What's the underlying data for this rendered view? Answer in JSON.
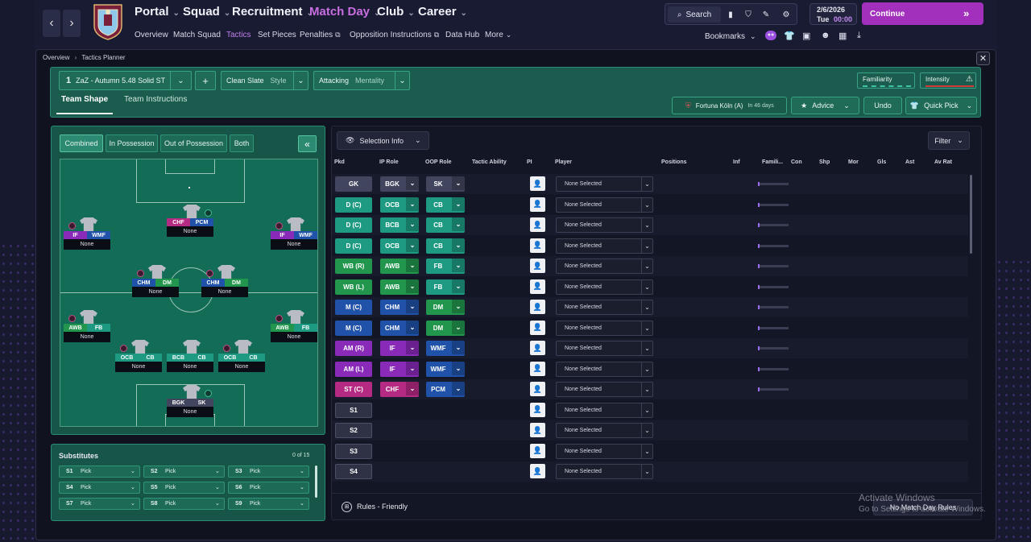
{
  "topnav": {
    "main": [
      {
        "label": "Portal"
      },
      {
        "label": "Squad"
      },
      {
        "label": "Recruitment"
      },
      {
        "label": "Match Day"
      },
      {
        "label": "Club"
      },
      {
        "label": "Career"
      }
    ],
    "sub": [
      "Overview",
      "Match Squad",
      "Tactics",
      "Set Pieces",
      "Penalties",
      "Opposition Instructions",
      "Data Hub",
      "More"
    ],
    "search": "Search",
    "date": "2/6/2026",
    "day": "Tue",
    "time": "00:00",
    "continue": "Continue",
    "bookmarks": "Bookmarks"
  },
  "breadcrumb": {
    "root": "Overview",
    "current": "Tactics Planner"
  },
  "tactic": {
    "slot": "1",
    "name": "ZaZ - Autumn 5.48 Solid ST",
    "style_value": "Clean Slate",
    "style_label": "Style",
    "mentality_value": "Attacking",
    "mentality_label": "Mentality",
    "familiarity": "Familiarity",
    "intensity": "Intensity",
    "tabs": [
      "Team Shape",
      "Team Instructions"
    ],
    "next_match": "Fortuna Köln (A)",
    "next_match_when": "In 46 days",
    "advice": "Advice",
    "undo": "Undo",
    "quick_pick": "Quick Pick"
  },
  "modes": [
    "Combined",
    "In Possession",
    "Out of Possession",
    "Both"
  ],
  "pitch_players": [
    {
      "ip": "CHF",
      "oop": "PCM",
      "name": "None"
    },
    {
      "ip": "IF",
      "oop": "WMF",
      "name": "None"
    },
    {
      "ip": "IF",
      "oop": "WMF",
      "name": "None"
    },
    {
      "ip": "CHM",
      "oop": "DM",
      "name": "None"
    },
    {
      "ip": "CHM",
      "oop": "DM",
      "name": "None"
    },
    {
      "ip": "AWB",
      "oop": "FB",
      "name": "None"
    },
    {
      "ip": "AWB",
      "oop": "FB",
      "name": "None"
    },
    {
      "ip": "OCB",
      "oop": "CB",
      "name": "None"
    },
    {
      "ip": "BCB",
      "oop": "CB",
      "name": "None"
    },
    {
      "ip": "OCB",
      "oop": "CB",
      "name": "None"
    },
    {
      "ip": "BGK",
      "oop": "SK",
      "name": "None"
    }
  ],
  "subs": {
    "title": "Substitutes",
    "count": "0 of 15",
    "slots": [
      {
        "s": "S1",
        "v": "Pick"
      },
      {
        "s": "S2",
        "v": "Pick"
      },
      {
        "s": "S3",
        "v": "Pick"
      },
      {
        "s": "S4",
        "v": "Pick"
      },
      {
        "s": "S5",
        "v": "Pick"
      },
      {
        "s": "S6",
        "v": "Pick"
      },
      {
        "s": "S7",
        "v": "Pick"
      },
      {
        "s": "S8",
        "v": "Pick"
      },
      {
        "s": "S9",
        "v": "Pick"
      }
    ]
  },
  "table": {
    "selection_info": "Selection Info",
    "filter": "Filter",
    "columns": [
      "Pkd",
      "IP Role",
      "OOP Role",
      "Tactic Ability",
      "PI",
      "Player",
      "Positions",
      "Inf",
      "Famili...",
      "Con",
      "Shp",
      "Mor",
      "Gls",
      "Ast",
      "Av Rat"
    ],
    "rows": [
      {
        "pos": "GK",
        "ip": "BGK",
        "oop": "SK",
        "player": "None Selected"
      },
      {
        "pos": "D (C)",
        "ip": "OCB",
        "oop": "CB",
        "player": "None Selected"
      },
      {
        "pos": "D (C)",
        "ip": "BCB",
        "oop": "CB",
        "player": "None Selected"
      },
      {
        "pos": "D (C)",
        "ip": "OCB",
        "oop": "CB",
        "player": "None Selected"
      },
      {
        "pos": "WB (R)",
        "ip": "AWB",
        "oop": "FB",
        "player": "None Selected"
      },
      {
        "pos": "WB (L)",
        "ip": "AWB",
        "oop": "FB",
        "player": "None Selected"
      },
      {
        "pos": "M (C)",
        "ip": "CHM",
        "oop": "DM",
        "player": "None Selected"
      },
      {
        "pos": "M (C)",
        "ip": "CHM",
        "oop": "DM",
        "player": "None Selected"
      },
      {
        "pos": "AM (R)",
        "ip": "IF",
        "oop": "WMF",
        "player": "None Selected"
      },
      {
        "pos": "AM (L)",
        "ip": "IF",
        "oop": "WMF",
        "player": "None Selected"
      },
      {
        "pos": "ST (C)",
        "ip": "CHF",
        "oop": "PCM",
        "player": "None Selected"
      },
      {
        "pos": "S1",
        "ip": "",
        "oop": "",
        "player": "None Selected"
      },
      {
        "pos": "S2",
        "ip": "",
        "oop": "",
        "player": "None Selected"
      },
      {
        "pos": "S3",
        "ip": "",
        "oop": "",
        "player": "None Selected"
      },
      {
        "pos": "S4",
        "ip": "",
        "oop": "",
        "player": "None Selected"
      }
    ],
    "rules": "Rules - Friendly",
    "no_rules": "No Match Day Rules"
  },
  "watermark": {
    "line1": "Activate Windows",
    "line2": "Go to Settings to activate Windows."
  },
  "colors": {
    "gk": "#42455e",
    "def": "#1e9a83",
    "wb": "#21964c",
    "mid": "#1f52a8",
    "am": "#8a2ab8",
    "st": "#b52a83",
    "sub": "#2f3244",
    "accent": "#a32fbd"
  }
}
